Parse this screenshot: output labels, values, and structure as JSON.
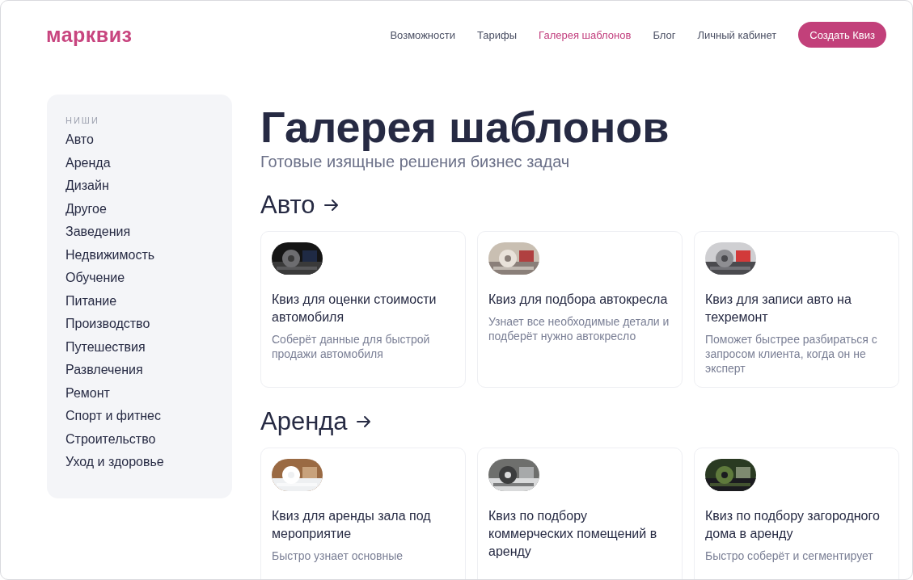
{
  "logo": "марквиз",
  "nav": [
    {
      "label": "Возможности",
      "selected": false
    },
    {
      "label": "Тарифы",
      "selected": false
    },
    {
      "label": "Галерея шаблонов",
      "selected": true
    },
    {
      "label": "Блог",
      "selected": false
    },
    {
      "label": "Личный кабинет",
      "selected": false
    }
  ],
  "cta": "Создать Квиз",
  "sidebar": {
    "heading": "НИШИ",
    "items": [
      "Авто",
      "Аренда",
      "Дизайн",
      "Другое",
      "Заведения",
      "Недвижимость",
      "Обучение",
      "Питание",
      "Производство",
      "Путешествия",
      "Развлечения",
      "Ремонт",
      "Спорт и фитнес",
      "Строительство",
      "Уход и здоровье"
    ]
  },
  "title": "Галерея шаблонов",
  "subtitle": "Готовые изящные решения бизнес задач",
  "sections": [
    {
      "title": "Авто",
      "cards": [
        {
          "title": "Квиз для оценки стоимости автомобиля",
          "description": "Соберёт данные для быстрой продажи автомобиля"
        },
        {
          "title": "Квиз для подбора автокресла",
          "description": "Узнает все необходимые детали и подберёт нужно автокресло"
        },
        {
          "title": "Квиз для записи авто на техремонт",
          "description": "Поможет быстрее разбираться с запросом клиента, когда он не эксперт"
        }
      ]
    },
    {
      "title": "Аренда",
      "cards": [
        {
          "title": "Квиз для аренды зала под мероприятие",
          "description": "Быстро узнает основные"
        },
        {
          "title": "Квиз по подбору коммерческих помещений в аренду"
        },
        {
          "title": "Квиз по подбору загородного дома в аренду",
          "description": "Быстро соберёт и сегментирует"
        }
      ]
    }
  ]
}
